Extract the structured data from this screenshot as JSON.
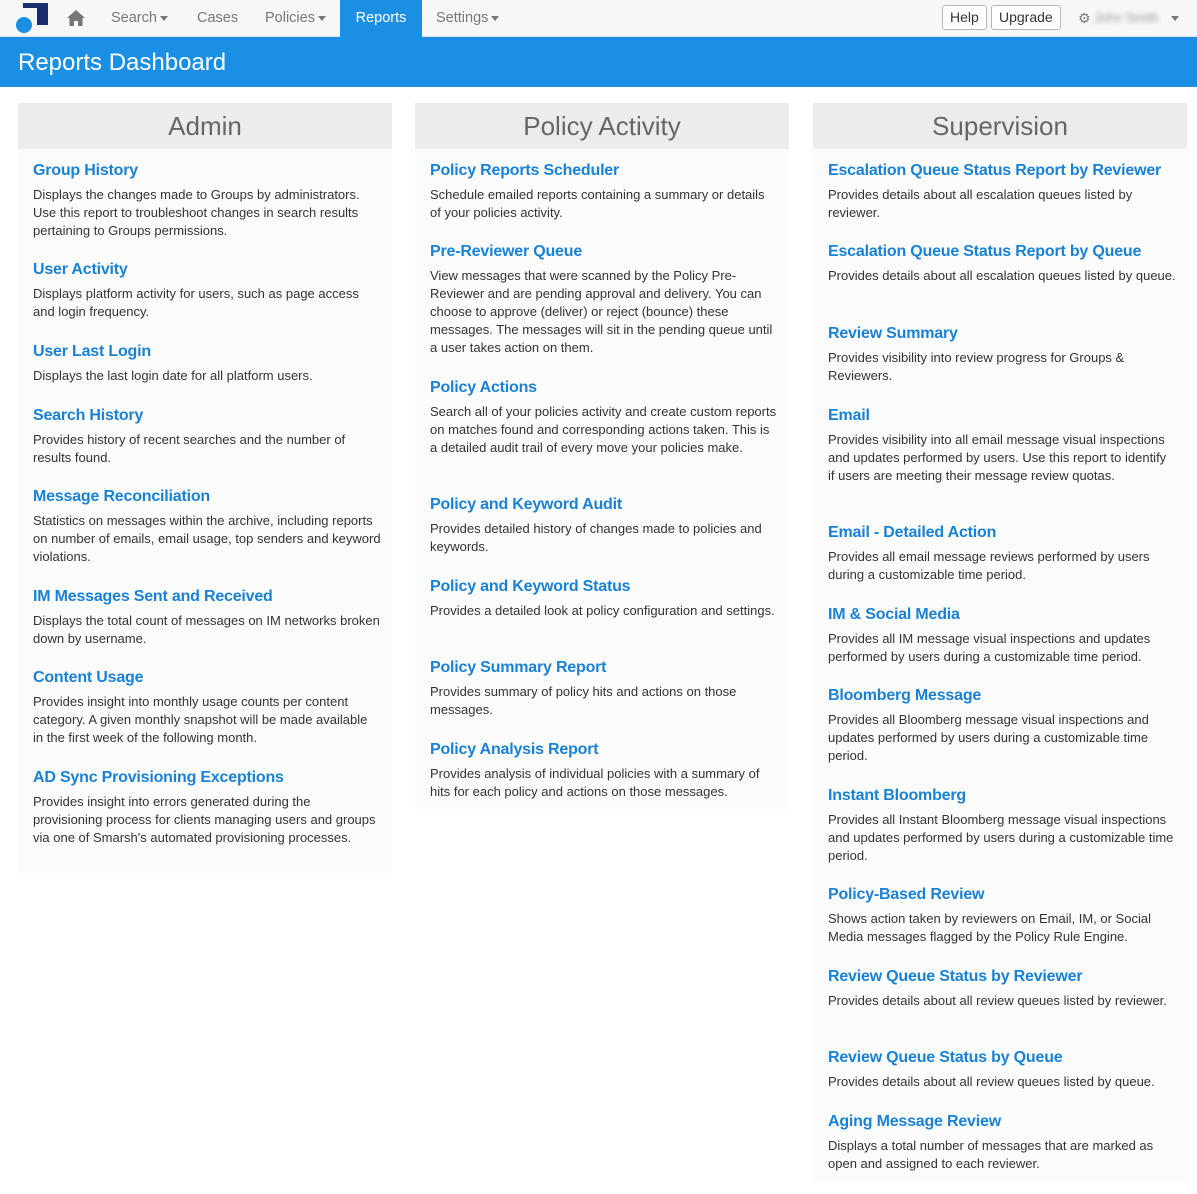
{
  "nav": {
    "search": "Search",
    "cases": "Cases",
    "policies": "Policies",
    "reports": "Reports",
    "settings": "Settings",
    "help": "Help",
    "upgrade": "Upgrade",
    "user": "John Smith",
    "accent_color": "#1a8fe3"
  },
  "page": {
    "title": "Reports Dashboard"
  },
  "columns": [
    {
      "heading": "Admin",
      "reports": [
        {
          "title": "Group History",
          "desc": "Displays the changes made to Groups by administrators. Use this report to troubleshoot changes in search results pertaining to Groups permissions."
        },
        {
          "title": "User Activity",
          "desc": "Displays platform activity for users, such as page access and login frequency."
        },
        {
          "title": "User Last Login",
          "desc": "Displays the last login date for all platform users."
        },
        {
          "title": "Search History",
          "desc": "Provides history of recent searches and the number of results found."
        },
        {
          "title": "Message Reconciliation",
          "desc": "Statistics on messages within the archive, including reports on number of emails, email usage, top senders and keyword violations."
        },
        {
          "title": "IM Messages Sent and Received",
          "desc": "Displays the total count of messages on IM networks broken down by username."
        },
        {
          "title": "Content Usage",
          "desc": "Provides insight into monthly usage counts per content category. A given monthly snapshot will be made available in the first week of the following month."
        },
        {
          "title": "AD Sync Provisioning Exceptions",
          "desc": "Provides insight into errors generated during the provisioning process for clients managing users and groups via one of Smarsh's automated provisioning processes."
        }
      ]
    },
    {
      "heading": "Policy Activity",
      "reports": [
        {
          "title": "Policy Reports Scheduler",
          "desc": "Schedule emailed reports containing a summary or details of your policies activity."
        },
        {
          "title": "Pre-Reviewer Queue",
          "desc": "View messages that were scanned by the Policy Pre-Reviewer and are pending approval and delivery. You can choose to approve (deliver) or reject (bounce) these messages. The messages will sit in the pending queue until a user takes action on them."
        },
        {
          "title": "Policy Actions",
          "desc": "Search all of your policies activity and create custom reports on matches found and corresponding actions taken. This is a detailed audit trail of every move your policies make."
        },
        {
          "title": "Policy and Keyword Audit",
          "desc": "Provides detailed history of changes made to policies and keywords."
        },
        {
          "title": "Policy and Keyword Status",
          "desc": "Provides a detailed look at policy configuration and settings."
        },
        {
          "title": "Policy Summary Report",
          "desc": "Provides summary of policy hits and actions on those messages."
        },
        {
          "title": "Policy Analysis Report",
          "desc": "Provides analysis of individual policies with a summary of hits for each policy and actions on those messages."
        }
      ]
    },
    {
      "heading": "Supervision",
      "reports": [
        {
          "title": "Escalation Queue Status Report by Reviewer",
          "desc": "Provides details about all escalation queues listed by reviewer."
        },
        {
          "title": "Escalation Queue Status Report by Queue",
          "desc": "Provides details about all escalation queues listed by queue."
        },
        {
          "title": "Review Summary",
          "desc": "Provides visibility into review progress for Groups & Reviewers."
        },
        {
          "title": "Email",
          "desc": "Provides visibility into all email message visual inspections and updates performed by users. Use this report to identify if users are meeting their message review quotas."
        },
        {
          "title": "Email - Detailed Action",
          "desc": "Provides all email message reviews performed by users during a customizable time period."
        },
        {
          "title": "IM & Social Media",
          "desc": "Provides all IM message visual inspections and updates performed by users during a customizable time period."
        },
        {
          "title": "Bloomberg Message",
          "desc": "Provides all Bloomberg message visual inspections and updates performed by users during a customizable time period."
        },
        {
          "title": "Instant Bloomberg",
          "desc": "Provides all Instant Bloomberg message visual inspections and updates performed by users during a customizable time period."
        },
        {
          "title": "Policy-Based Review",
          "desc": "Shows action taken by reviewers on Email, IM, or Social Media messages flagged by the Policy Rule Engine."
        },
        {
          "title": "Review Queue Status by Reviewer",
          "desc": "Provides details about all review queues listed by reviewer."
        },
        {
          "title": "Review Queue Status by Queue",
          "desc": "Provides details about all review queues listed by queue."
        },
        {
          "title": "Aging Message Review",
          "desc": "Displays a total number of messages that are marked as open and assigned to each reviewer."
        }
      ]
    }
  ]
}
